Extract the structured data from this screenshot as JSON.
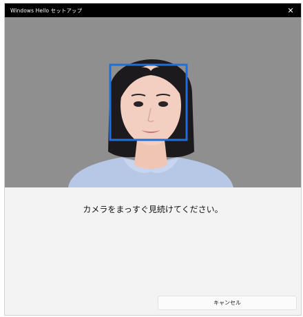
{
  "window": {
    "title": "Windows Hello セットアップ",
    "close_glyph": "✕"
  },
  "camera": {
    "feed": "person-face",
    "face_box_color": "#1e6fd9"
  },
  "instruction": "カメラをまっすぐ見続けてください。",
  "buttons": {
    "cancel_label": "キャンセル"
  }
}
